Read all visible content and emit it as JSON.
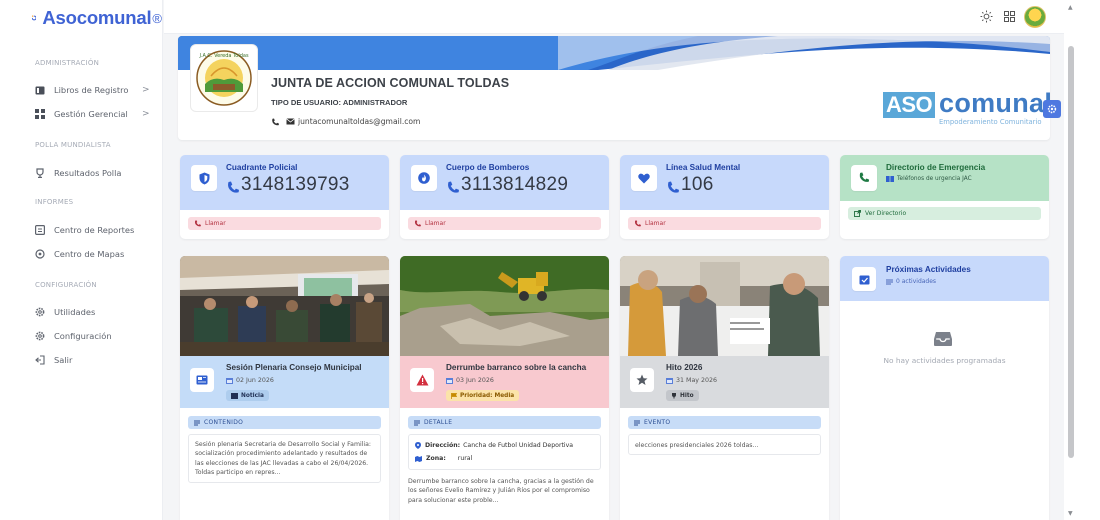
{
  "app": {
    "name": "Asocomunal",
    "registered": "®"
  },
  "sidebar": {
    "sections": [
      {
        "label": "ADMINISTRACIÓN"
      },
      {
        "label": "POLLA MUNDIALISTA"
      },
      {
        "label": "INFORMES"
      },
      {
        "label": "CONFIGURACIÓN"
      }
    ],
    "items": [
      {
        "label": "Libros de Registro",
        "icon": "book-icon",
        "chevron": ">"
      },
      {
        "label": "Gestión Gerencial",
        "icon": "grid-icon",
        "chevron": ">"
      },
      {
        "label": "Resultados Polla",
        "icon": "trophy-icon"
      },
      {
        "label": "Centro de Reportes",
        "icon": "report-icon"
      },
      {
        "label": "Centro de Mapas",
        "icon": "map-pin-icon"
      },
      {
        "label": "Utilidades",
        "icon": "gear-icon"
      },
      {
        "label": "Configuración",
        "icon": "gear-icon"
      },
      {
        "label": "Salir",
        "icon": "logout-icon"
      }
    ]
  },
  "topbar": {
    "icons": [
      "sun-icon",
      "apps-grid-icon",
      "user-avatar"
    ]
  },
  "profile": {
    "org_name": "JUNTA DE ACCION COMUNAL TOLDAS",
    "user_type": "TIPO DE USUARIO: ADMINISTRADOR",
    "email": "juntacomunaltoldas@gmail.com",
    "logo_text": "J.A.C. Vereda Toldas",
    "brand": {
      "aso": "ASO",
      "comunal": "comunal",
      "tagline": "Empoderamiento Comunitario"
    }
  },
  "emergency": [
    {
      "title": "Cuadrante Policial",
      "number": "3148139793",
      "action": "Llamar",
      "icon": "shield-icon"
    },
    {
      "title": "Cuerpo de Bomberos",
      "number": "3113814829",
      "action": "Llamar",
      "icon": "fire-icon"
    },
    {
      "title": "Línea Salud Mental",
      "number": "106",
      "action": "Llamar",
      "icon": "heart-icon"
    },
    {
      "title": "Directorio de Emergencia",
      "subtitle": "Teléfonos de urgencia JAC",
      "action": "Ver Directorio",
      "icon": "phone-icon"
    }
  ],
  "news": [
    {
      "title": "Sesión Plenaria Consejo Municipal",
      "date": "02 Jun 2026",
      "tag": "Noticia",
      "section": "CONTENIDO",
      "body": "Sesión plenaria Secretaria de Desarrollo Social y Familia: socialización procedimiento adelantado y resultados de las elecciones de las JAC llevadas a cabo el 26/04/2026. Toldas participo en repres...",
      "icon": "newspaper-icon"
    },
    {
      "title": "Derrumbe barranco sobre la cancha",
      "date": "03 Jun 2026",
      "tag": "Prioridad: Media",
      "section": "DETALLE",
      "direccion_label": "Dirección:",
      "direccion": "Cancha de Futbol Unidad Deportiva",
      "zona_label": "Zona:",
      "zona": "rural",
      "body": "Derrumbe barranco sobre la cancha, gracias a la gestión de los señores Evelio Ramírez y Julián Ríos por el compromiso para solucionar este proble...",
      "icon": "warning-icon"
    },
    {
      "title": "Hito 2026",
      "date": "31 May 2026",
      "tag": "Hito",
      "section": "EVENTO",
      "body": "elecciones presidenciales 2026 toldas...",
      "icon": "star-icon"
    }
  ],
  "activities": {
    "title": "Próximas Actividades",
    "count": "0 actividades",
    "empty": "No hay actividades programadas"
  },
  "colors": {
    "primary": "#3f63d4",
    "card_blue": "#c7d9fb",
    "card_green": "#b6e2c6",
    "card_red": "#f8c9cf",
    "card_gray": "#d9dbde",
    "danger": "#b2303f"
  }
}
